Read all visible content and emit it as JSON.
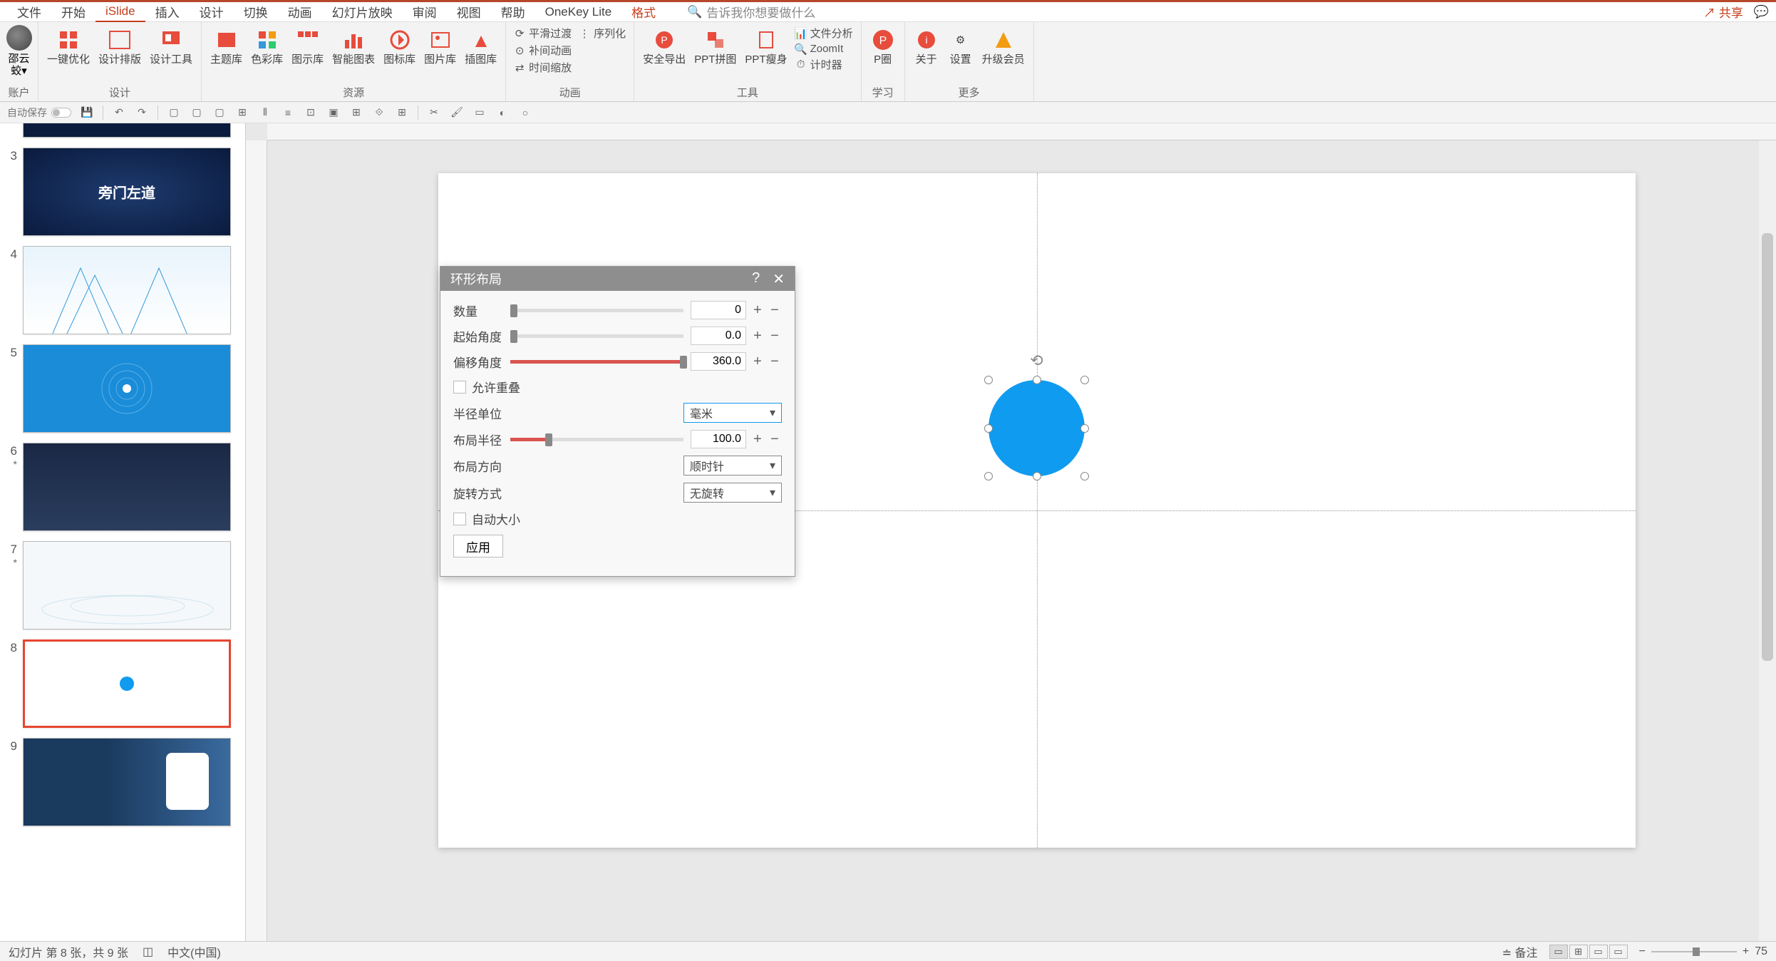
{
  "menu": {
    "items": [
      "文件",
      "开始",
      "iSlide",
      "插入",
      "设计",
      "切换",
      "动画",
      "幻灯片放映",
      "审阅",
      "视图",
      "帮助",
      "OneKey Lite",
      "格式"
    ],
    "active_index": 2,
    "format_index": 12,
    "tell_me": "告诉我你想要做什么",
    "share": "共享"
  },
  "ribbon": {
    "groups": {
      "account": {
        "label": "账户",
        "user_name": "邵云蛟",
        "dropdown": "▾"
      },
      "design": {
        "label": "设计",
        "buttons": [
          "一键优化",
          "设计排版",
          "设计工具"
        ]
      },
      "resources": {
        "label": "资源",
        "buttons": [
          "主题库",
          "色彩库",
          "图示库",
          "智能图表",
          "图标库",
          "图片库",
          "插图库"
        ]
      },
      "animation": {
        "label": "动画",
        "items": [
          "平滑过渡",
          "补间动画",
          "时间缩放",
          "序列化"
        ]
      },
      "tools": {
        "label": "工具",
        "buttons": [
          "安全导出",
          "PPT拼图",
          "PPT瘦身"
        ],
        "items": [
          "文件分析",
          "ZoomIt",
          "计时器"
        ]
      },
      "study": {
        "label": "学习",
        "button": "P圈"
      },
      "more": {
        "label": "更多",
        "buttons": [
          "关于",
          "设置",
          "升级会员"
        ]
      }
    }
  },
  "qat": {
    "autosave": "自动保存"
  },
  "slides": {
    "thumbs": [
      {
        "num": "3",
        "modified": ""
      },
      {
        "num": "4",
        "modified": ""
      },
      {
        "num": "5",
        "modified": ""
      },
      {
        "num": "6",
        "modified": "*"
      },
      {
        "num": "7",
        "modified": "*"
      },
      {
        "num": "8",
        "modified": "",
        "active": true
      },
      {
        "num": "9",
        "modified": ""
      }
    ],
    "title_text": "旁门左道"
  },
  "dialog": {
    "title": "环形布局",
    "count_label": "数量",
    "count_value": "0",
    "start_angle_label": "起始角度",
    "start_angle_value": "0.0",
    "offset_angle_label": "偏移角度",
    "offset_angle_value": "360.0",
    "allow_overlap_label": "允许重叠",
    "radius_unit_label": "半径单位",
    "radius_unit_value": "毫米",
    "layout_radius_label": "布局半径",
    "layout_radius_value": "100.0",
    "direction_label": "布局方向",
    "direction_value": "顺时针",
    "rotation_label": "旋转方式",
    "rotation_value": "无旋转",
    "auto_size_label": "自动大小",
    "apply_button": "应用"
  },
  "status": {
    "slide_info": "幻灯片 第 8 张，共 9 张",
    "language": "中文(中国)",
    "notes": "备注",
    "zoom": "75"
  }
}
